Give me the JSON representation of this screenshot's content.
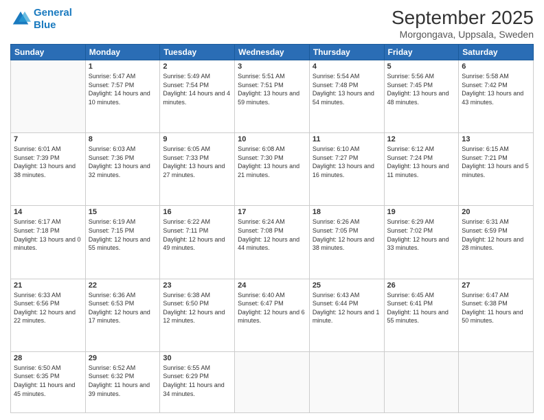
{
  "logo": {
    "line1": "General",
    "line2": "Blue"
  },
  "header": {
    "title": "September 2025",
    "location": "Morgongava, Uppsala, Sweden"
  },
  "weekdays": [
    "Sunday",
    "Monday",
    "Tuesday",
    "Wednesday",
    "Thursday",
    "Friday",
    "Saturday"
  ],
  "weeks": [
    [
      null,
      {
        "day": 1,
        "sunrise": "5:47 AM",
        "sunset": "7:57 PM",
        "daylight": "14 hours and 10 minutes."
      },
      {
        "day": 2,
        "sunrise": "5:49 AM",
        "sunset": "7:54 PM",
        "daylight": "14 hours and 4 minutes."
      },
      {
        "day": 3,
        "sunrise": "5:51 AM",
        "sunset": "7:51 PM",
        "daylight": "13 hours and 59 minutes."
      },
      {
        "day": 4,
        "sunrise": "5:54 AM",
        "sunset": "7:48 PM",
        "daylight": "13 hours and 54 minutes."
      },
      {
        "day": 5,
        "sunrise": "5:56 AM",
        "sunset": "7:45 PM",
        "daylight": "13 hours and 48 minutes."
      },
      {
        "day": 6,
        "sunrise": "5:58 AM",
        "sunset": "7:42 PM",
        "daylight": "13 hours and 43 minutes."
      }
    ],
    [
      {
        "day": 7,
        "sunrise": "6:01 AM",
        "sunset": "7:39 PM",
        "daylight": "13 hours and 38 minutes."
      },
      {
        "day": 8,
        "sunrise": "6:03 AM",
        "sunset": "7:36 PM",
        "daylight": "13 hours and 32 minutes."
      },
      {
        "day": 9,
        "sunrise": "6:05 AM",
        "sunset": "7:33 PM",
        "daylight": "13 hours and 27 minutes."
      },
      {
        "day": 10,
        "sunrise": "6:08 AM",
        "sunset": "7:30 PM",
        "daylight": "13 hours and 21 minutes."
      },
      {
        "day": 11,
        "sunrise": "6:10 AM",
        "sunset": "7:27 PM",
        "daylight": "13 hours and 16 minutes."
      },
      {
        "day": 12,
        "sunrise": "6:12 AM",
        "sunset": "7:24 PM",
        "daylight": "13 hours and 11 minutes."
      },
      {
        "day": 13,
        "sunrise": "6:15 AM",
        "sunset": "7:21 PM",
        "daylight": "13 hours and 5 minutes."
      }
    ],
    [
      {
        "day": 14,
        "sunrise": "6:17 AM",
        "sunset": "7:18 PM",
        "daylight": "13 hours and 0 minutes."
      },
      {
        "day": 15,
        "sunrise": "6:19 AM",
        "sunset": "7:15 PM",
        "daylight": "12 hours and 55 minutes."
      },
      {
        "day": 16,
        "sunrise": "6:22 AM",
        "sunset": "7:11 PM",
        "daylight": "12 hours and 49 minutes."
      },
      {
        "day": 17,
        "sunrise": "6:24 AM",
        "sunset": "7:08 PM",
        "daylight": "12 hours and 44 minutes."
      },
      {
        "day": 18,
        "sunrise": "6:26 AM",
        "sunset": "7:05 PM",
        "daylight": "12 hours and 38 minutes."
      },
      {
        "day": 19,
        "sunrise": "6:29 AM",
        "sunset": "7:02 PM",
        "daylight": "12 hours and 33 minutes."
      },
      {
        "day": 20,
        "sunrise": "6:31 AM",
        "sunset": "6:59 PM",
        "daylight": "12 hours and 28 minutes."
      }
    ],
    [
      {
        "day": 21,
        "sunrise": "6:33 AM",
        "sunset": "6:56 PM",
        "daylight": "12 hours and 22 minutes."
      },
      {
        "day": 22,
        "sunrise": "6:36 AM",
        "sunset": "6:53 PM",
        "daylight": "12 hours and 17 minutes."
      },
      {
        "day": 23,
        "sunrise": "6:38 AM",
        "sunset": "6:50 PM",
        "daylight": "12 hours and 12 minutes."
      },
      {
        "day": 24,
        "sunrise": "6:40 AM",
        "sunset": "6:47 PM",
        "daylight": "12 hours and 6 minutes."
      },
      {
        "day": 25,
        "sunrise": "6:43 AM",
        "sunset": "6:44 PM",
        "daylight": "12 hours and 1 minute."
      },
      {
        "day": 26,
        "sunrise": "6:45 AM",
        "sunset": "6:41 PM",
        "daylight": "11 hours and 55 minutes."
      },
      {
        "day": 27,
        "sunrise": "6:47 AM",
        "sunset": "6:38 PM",
        "daylight": "11 hours and 50 minutes."
      }
    ],
    [
      {
        "day": 28,
        "sunrise": "6:50 AM",
        "sunset": "6:35 PM",
        "daylight": "11 hours and 45 minutes."
      },
      {
        "day": 29,
        "sunrise": "6:52 AM",
        "sunset": "6:32 PM",
        "daylight": "11 hours and 39 minutes."
      },
      {
        "day": 30,
        "sunrise": "6:55 AM",
        "sunset": "6:29 PM",
        "daylight": "11 hours and 34 minutes."
      },
      null,
      null,
      null,
      null
    ]
  ]
}
